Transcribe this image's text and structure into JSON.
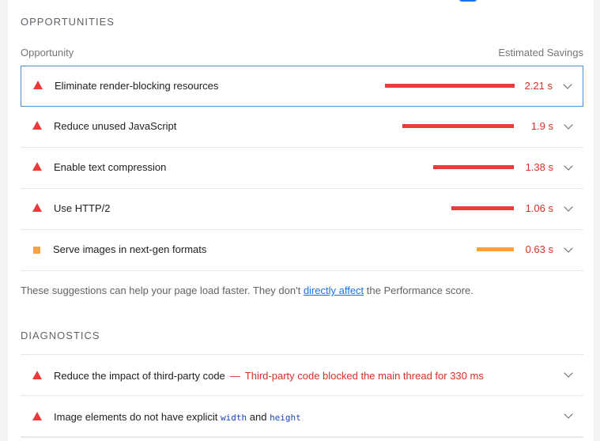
{
  "sections": {
    "opportunities_title": "OPPORTUNITIES",
    "diagnostics_title": "DIAGNOSTICS"
  },
  "headers": {
    "opportunity": "Opportunity",
    "savings": "Estimated Savings"
  },
  "opportunities": [
    {
      "title": "Eliminate render-blocking resources",
      "savings": "2.21 s",
      "savings_seconds": 2.21,
      "severity": "fail",
      "icon": "red-triangle-icon"
    },
    {
      "title": "Reduce unused JavaScript",
      "savings": "1.9 s",
      "savings_seconds": 1.9,
      "severity": "fail",
      "icon": "red-triangle-icon"
    },
    {
      "title": "Enable text compression",
      "savings": "1.38 s",
      "savings_seconds": 1.38,
      "severity": "fail",
      "icon": "red-triangle-icon"
    },
    {
      "title": "Use HTTP/2",
      "savings": "1.06 s",
      "savings_seconds": 1.06,
      "severity": "fail",
      "icon": "red-triangle-icon"
    },
    {
      "title": "Serve images in next-gen formats",
      "savings": "0.63 s",
      "savings_seconds": 0.63,
      "severity": "average",
      "icon": "orange-square-icon"
    }
  ],
  "note": {
    "before": "These suggestions can help your page load faster. They don't ",
    "link": "directly affect",
    "after": " the Performance score."
  },
  "diagnostics": [
    {
      "title": "Reduce the impact of third-party code",
      "separator": "—",
      "detail": "Third-party code blocked the main thread for 330 ms"
    },
    {
      "title_prefix": "Image elements do not have explicit ",
      "code1": "width",
      "conj": " and ",
      "code2": "height"
    }
  ],
  "colors": {
    "fail": "#eb3a3a",
    "average": "#f7a33a",
    "link": "#1a73e8"
  }
}
